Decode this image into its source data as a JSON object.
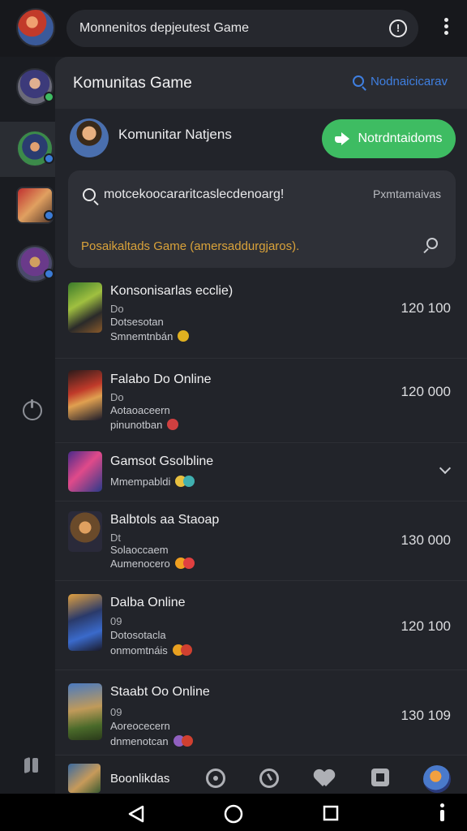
{
  "header": {
    "search_title": "Monnenitos depjeutest Game",
    "info_icon": "info-circle-icon",
    "menu_icon": "more-vertical-icon"
  },
  "panel": {
    "title": "Komunitas Game",
    "search_link": "Nodnaicicarav",
    "community_name": "Komunitar Natjens",
    "notify_button": "Notrdntaidoms",
    "search_query": "motcekoocararitcaslecdenoarg!",
    "filter_label": "Pxmtamaivas",
    "suggestion": "Posaikaltads Game (amersaddurgjaros)."
  },
  "games": [
    {
      "name": "Konsonisarlas ecclie)",
      "line1": "Do",
      "line2": "Dotsesotan",
      "line3": "Smnemtnbán",
      "count": "120 100",
      "emoji_color": "#e0b020"
    },
    {
      "name": "Falabo Do Online",
      "line1": "Do",
      "line2": "Aotaoaceern",
      "line3": "pinunotban",
      "count": "120 000",
      "emoji_color": "#d04040"
    },
    {
      "name": "Gamsot Gsolbline",
      "line1": "",
      "line2": "",
      "line3": "Mmempabldi",
      "count": "",
      "emoji_color": "#e8c040"
    },
    {
      "name": "Balbtols aa Staoap",
      "line1": "Dt",
      "line2": "Solaoccaem",
      "line3": "Aumenocero",
      "count": "130 000",
      "emoji_color": "#f0a020"
    },
    {
      "name": "Dalba Online",
      "line1": "09",
      "line2": "Dotosotacla",
      "line3": "onmomtnáis",
      "count": "120 100",
      "emoji_color": "#e8a020"
    },
    {
      "name": "Staabt Oo Online",
      "line1": "09",
      "line2": "Aoreocecern",
      "line3": "dnmenotcan",
      "count": "130 109",
      "emoji_color": "#9060c0"
    }
  ],
  "tabbar": {
    "label": "Boonlikdas"
  }
}
